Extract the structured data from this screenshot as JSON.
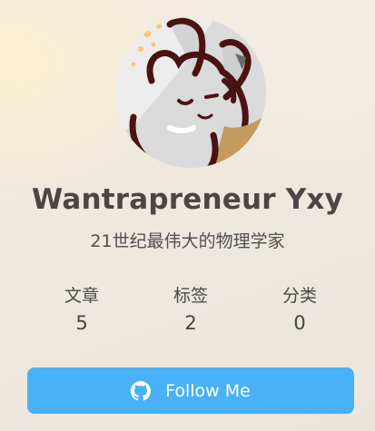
{
  "profile": {
    "name": "Wantrapreneur Yxy",
    "bio": "21世纪最伟大的物理学家"
  },
  "stats": [
    {
      "label": "文章",
      "value": "5"
    },
    {
      "label": "标签",
      "value": "2"
    },
    {
      "label": "分类",
      "value": "0"
    }
  ],
  "follow_button": {
    "label": "Follow Me",
    "icon": "github-icon"
  },
  "colors": {
    "accent": "#49b1f5",
    "name_text": "#4b4644"
  }
}
